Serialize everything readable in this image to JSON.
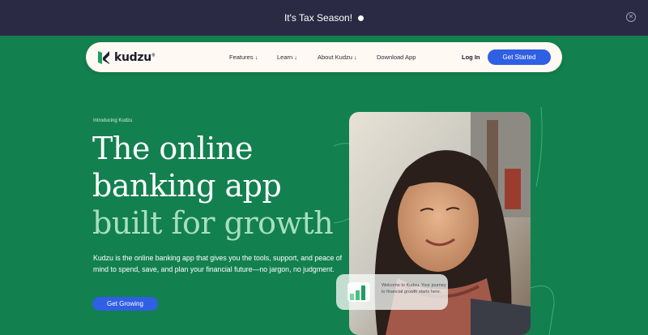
{
  "banner": {
    "text": "It's Tax Season!",
    "close_icon": "close-icon"
  },
  "nav": {
    "logo_text": "kudzu",
    "logo_mark": "®",
    "items": [
      {
        "label": "Features",
        "icon": "chevron-down-icon"
      },
      {
        "label": "Learn",
        "icon": "chevron-down-icon"
      },
      {
        "label": "About Kudzu",
        "icon": "chevron-down-icon"
      },
      {
        "label": "Download App"
      }
    ],
    "login_label": "Log In",
    "cta_label": "Get Started"
  },
  "hero": {
    "eyebrow": "Introducing Kudzu",
    "headline_line1": "The online",
    "headline_line2": "banking app",
    "headline_line3": "built for growth",
    "description": "Kudzu is the online banking app that gives you the tools, support, and peace of mind to spend, save, and plan your financial future—no jargon, no judgment.",
    "cta_label": "Get Growing"
  },
  "message_card": {
    "text": "Welcome to Kudzu. Your journey to financial growth starts here."
  },
  "colors": {
    "background": "#13804f",
    "banner": "#2a2a44",
    "accent_blue": "#2f5fe3",
    "headline_highlight": "#a7dfc0",
    "nav_bg": "#fff9f3"
  }
}
